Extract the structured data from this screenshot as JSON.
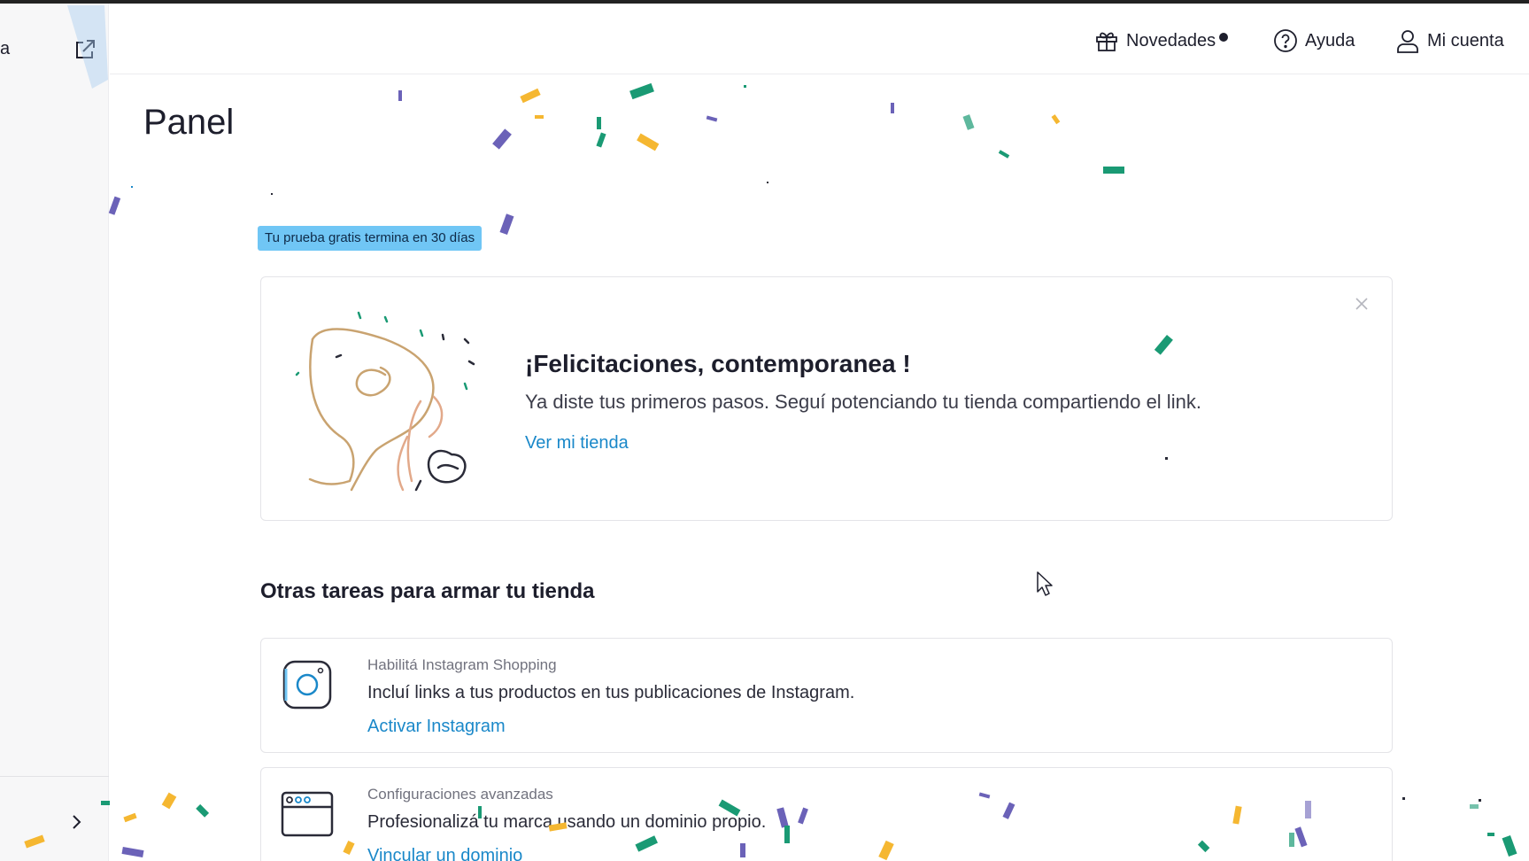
{
  "sidebar": {
    "partial_label": "a",
    "external_link_icon": "external-link-icon",
    "collapse_icon": "chevron-right-icon"
  },
  "header": {
    "news_label": "Novedades",
    "help_label": "Ayuda",
    "account_label": "Mi cuenta"
  },
  "page": {
    "title": "Panel",
    "trial_badge": "Tu prueba gratis termina en 30 días"
  },
  "congrats": {
    "title": "¡Felicitaciones, contemporanea !",
    "description": "Ya diste tus primeros pasos. Seguí potenciando tu tienda compartiendo el link.",
    "link": "Ver mi tienda"
  },
  "tasks": {
    "section_title": "Otras tareas para armar tu tienda",
    "items": [
      {
        "label": "Habilitá Instagram Shopping",
        "description": "Incluí links a tus productos en tus publicaciones de Instagram.",
        "link": "Activar Instagram",
        "icon": "instagram-icon"
      },
      {
        "label": "Configuraciones avanzadas",
        "description": "Profesionalizá tu marca usando un dominio propio.",
        "link": "Vincular un dominio",
        "icon": "browser-window-icon"
      }
    ]
  },
  "colors": {
    "link": "#1a88c9",
    "badge_bg": "#70c6f5",
    "confetti_green": "#1a9a74",
    "confetti_yellow": "#f5b731",
    "confetti_purple": "#6b62b8"
  }
}
